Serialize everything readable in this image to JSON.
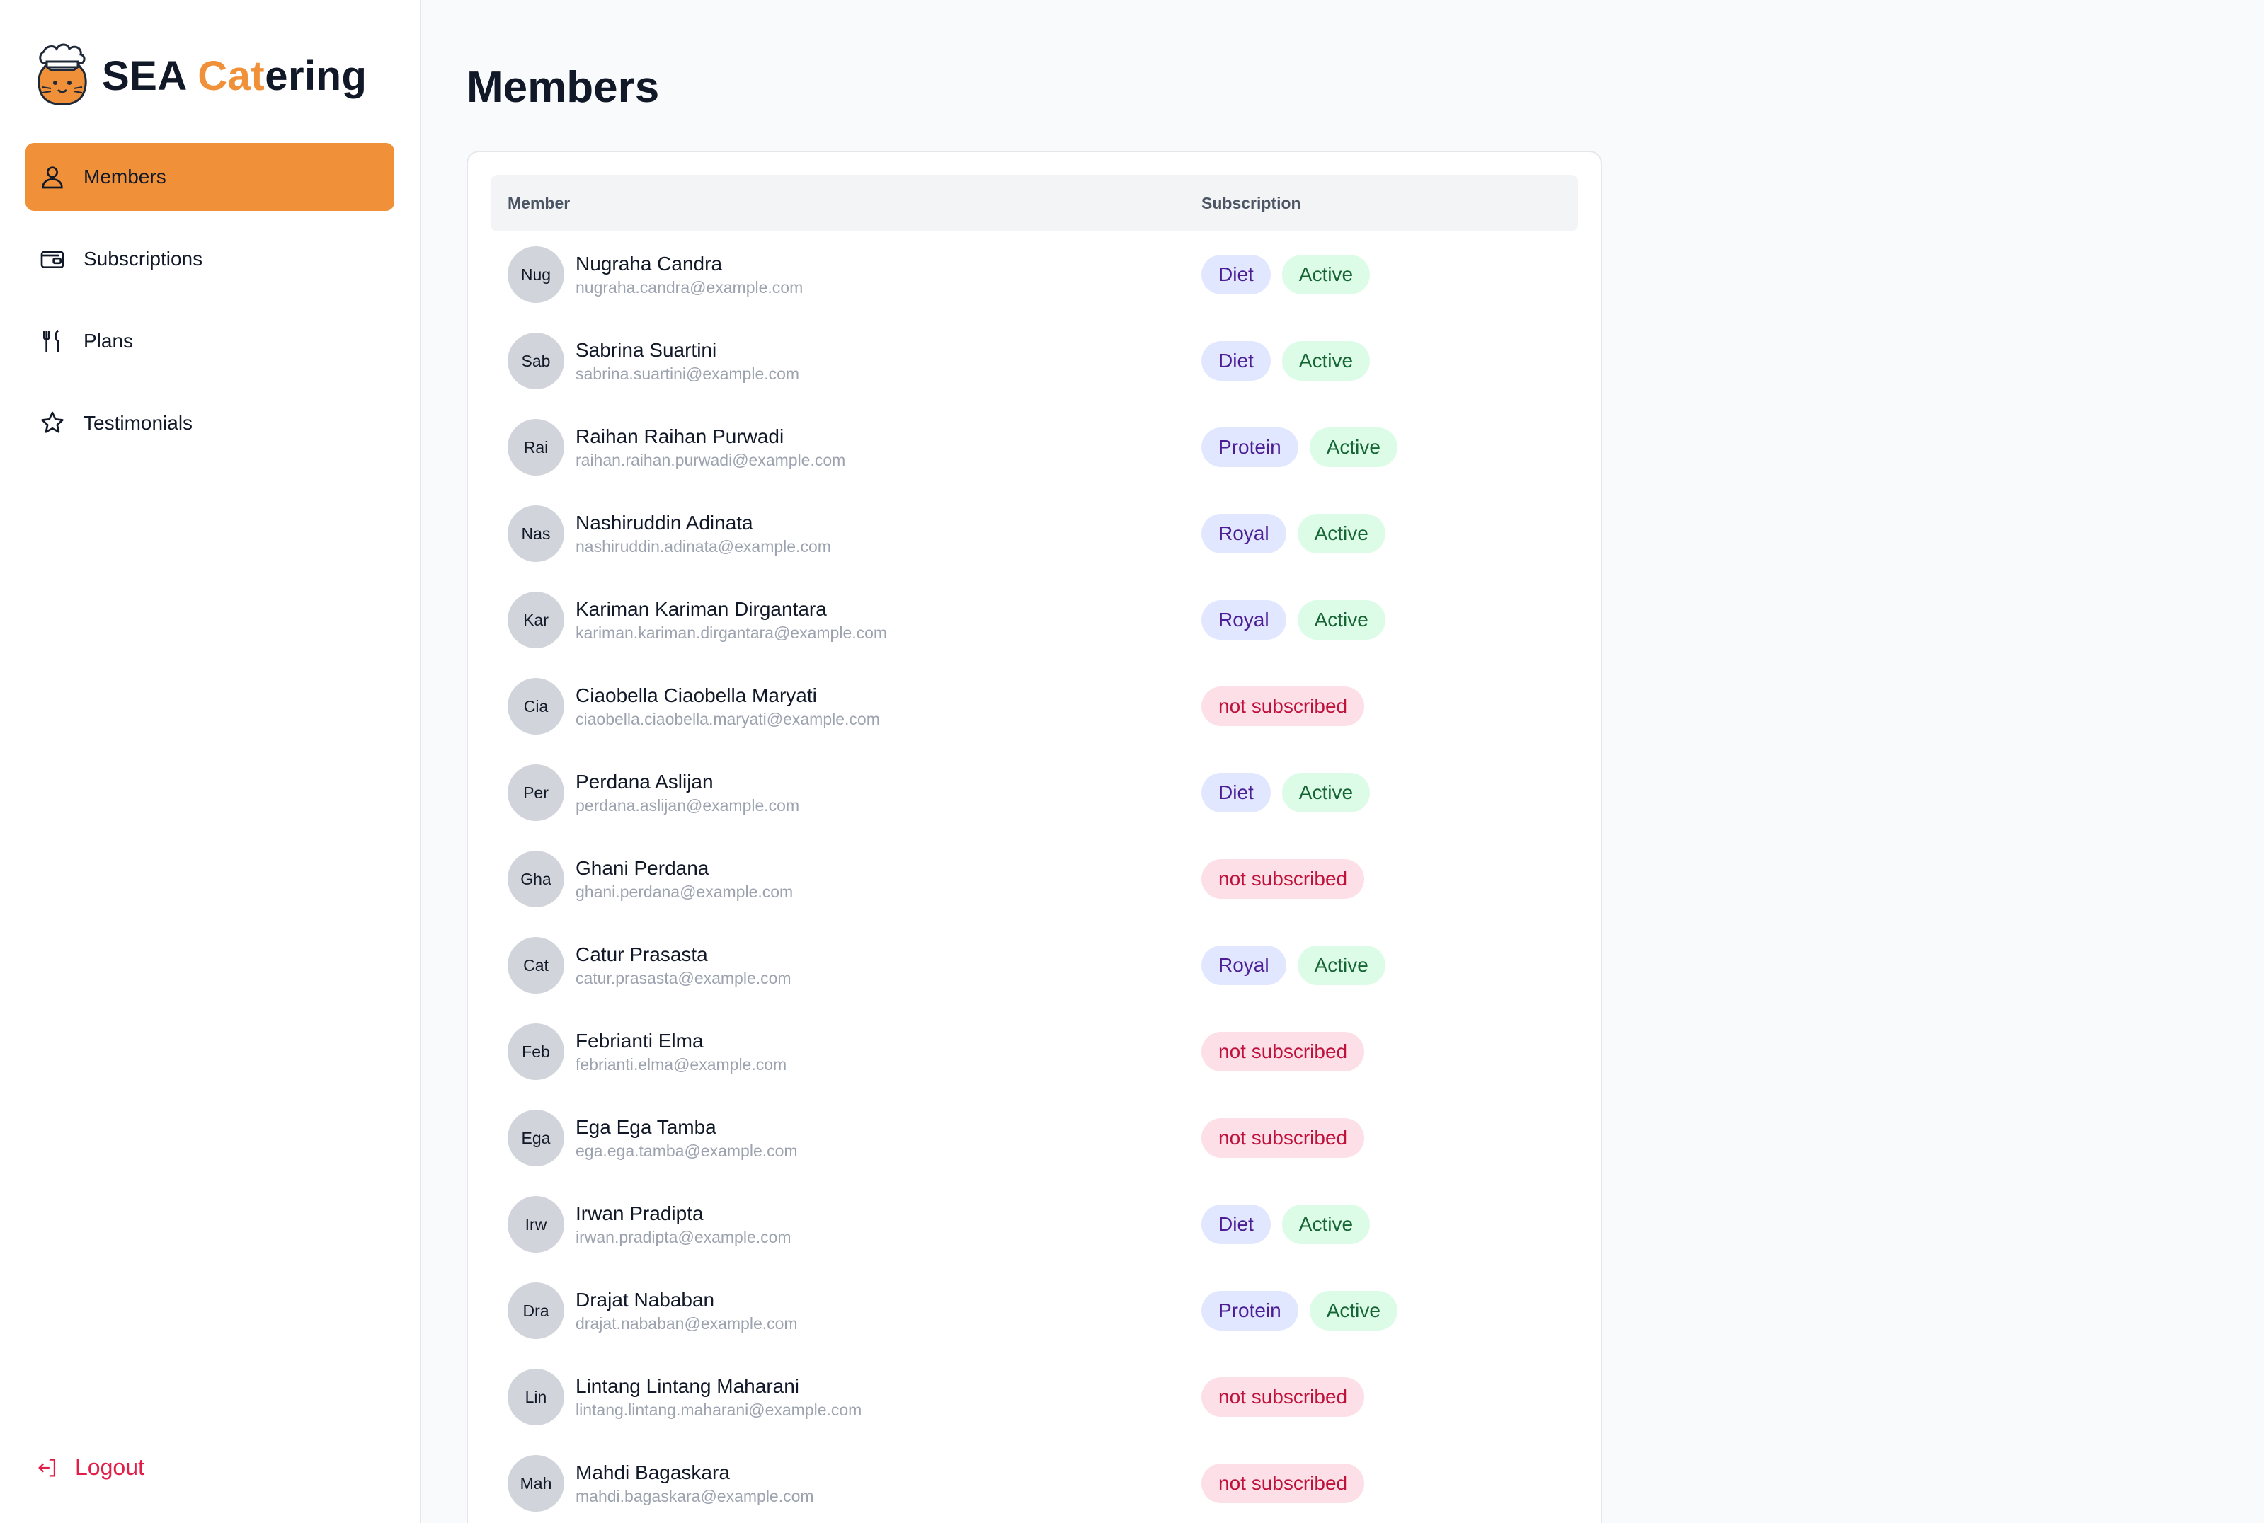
{
  "brand": {
    "name_start": "SEA ",
    "name_accent": "Cat",
    "name_end": "ering",
    "accent_color": "#f0913a"
  },
  "sidebar": {
    "items": [
      {
        "label": "Members",
        "icon": "user-icon",
        "active": true
      },
      {
        "label": "Subscriptions",
        "icon": "wallet-icon",
        "active": false
      },
      {
        "label": "Plans",
        "icon": "utensils-icon",
        "active": false
      },
      {
        "label": "Testimonials",
        "icon": "star-icon",
        "active": false
      }
    ],
    "logout_label": "Logout"
  },
  "main": {
    "title": "Members",
    "table": {
      "columns": [
        "Member",
        "Subscription"
      ],
      "rows": [
        {
          "initials": "Nug",
          "name": "Nugraha Candra",
          "email": "nugraha.candra@example.com",
          "plan": "Diet",
          "status": "Active"
        },
        {
          "initials": "Sab",
          "name": "Sabrina Suartini",
          "email": "sabrina.suartini@example.com",
          "plan": "Diet",
          "status": "Active"
        },
        {
          "initials": "Rai",
          "name": "Raihan Raihan Purwadi",
          "email": "raihan.raihan.purwadi@example.com",
          "plan": "Protein",
          "status": "Active"
        },
        {
          "initials": "Nas",
          "name": "Nashiruddin Adinata",
          "email": "nashiruddin.adinata@example.com",
          "plan": "Royal",
          "status": "Active"
        },
        {
          "initials": "Kar",
          "name": "Kariman Kariman Dirgantara",
          "email": "kariman.kariman.dirgantara@example.com",
          "plan": "Royal",
          "status": "Active"
        },
        {
          "initials": "Cia",
          "name": "Ciaobella Ciaobella Maryati",
          "email": "ciaobella.ciaobella.maryati@example.com",
          "plan": "",
          "status": "not subscribed"
        },
        {
          "initials": "Per",
          "name": "Perdana Aslijan",
          "email": "perdana.aslijan@example.com",
          "plan": "Diet",
          "status": "Active"
        },
        {
          "initials": "Gha",
          "name": "Ghani Perdana",
          "email": "ghani.perdana@example.com",
          "plan": "",
          "status": "not subscribed"
        },
        {
          "initials": "Cat",
          "name": "Catur Prasasta",
          "email": "catur.prasasta@example.com",
          "plan": "Royal",
          "status": "Active"
        },
        {
          "initials": "Feb",
          "name": "Febrianti Elma",
          "email": "febrianti.elma@example.com",
          "plan": "",
          "status": "not subscribed"
        },
        {
          "initials": "Ega",
          "name": "Ega Ega Tamba",
          "email": "ega.ega.tamba@example.com",
          "plan": "",
          "status": "not subscribed"
        },
        {
          "initials": "Irw",
          "name": "Irwan Pradipta",
          "email": "irwan.pradipta@example.com",
          "plan": "Diet",
          "status": "Active"
        },
        {
          "initials": "Dra",
          "name": "Drajat Nababan",
          "email": "drajat.nababan@example.com",
          "plan": "Protein",
          "status": "Active"
        },
        {
          "initials": "Lin",
          "name": "Lintang Lintang Maharani",
          "email": "lintang.lintang.maharani@example.com",
          "plan": "",
          "status": "not subscribed"
        },
        {
          "initials": "Mah",
          "name": "Mahdi Bagaskara",
          "email": "mahdi.bagaskara@example.com",
          "plan": "",
          "status": "not subscribed"
        }
      ]
    }
  }
}
